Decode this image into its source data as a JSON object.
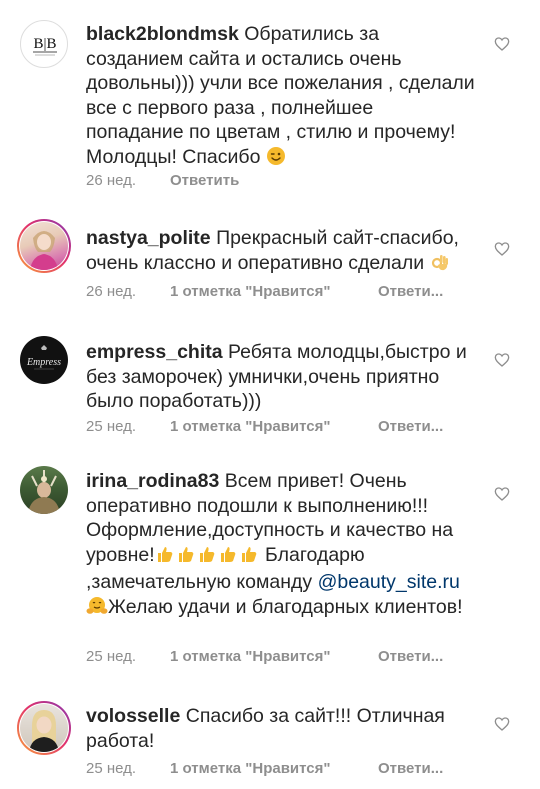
{
  "comments": [
    {
      "username": "black2blondmsk",
      "text": "Обратились за созданием сайта и остались очень довольны))) учли все пожелания , сделали все с первого раза , полнейшее попадание по цветам , стилю и прочему! Молодцы! Спасибо",
      "emoji": "wink-emoji",
      "avatar_text": "B|B",
      "time": "26 нед.",
      "likes": "",
      "reply": "Ответить"
    },
    {
      "username": "nastya_polite",
      "text": "Прекрасный сайт-спасибо, очень классно и оперативно сделали",
      "emoji": "ok-hand-emoji",
      "time": "26 нед.",
      "likes": "1 отметка \"Нравится\"",
      "reply": "Ответи..."
    },
    {
      "username": "empress_chita",
      "text": "Ребята молодцы,быстро и без заморочек) умнички,очень приятно было поработать)))",
      "avatar_text": "Empress",
      "time": "25 нед.",
      "likes": "1 отметка \"Нравится\"",
      "reply": "Ответи..."
    },
    {
      "username": "irina_rodina83",
      "text_part1": "Всем привет!  Очень оперативно подошли к выполнению!!! Оформление,доступность и качество на уровне!",
      "text_part2": "Благодарю ,замечательную команду",
      "mention": "@beauty_site.ru",
      "text_part3": "Желаю удачи и благодарных клиентов!",
      "emoji_thumbs": "thumbs-up-emoji",
      "emoji_hug": "hugging-emoji",
      "time": "25 нед.",
      "likes": "1 отметка \"Нравится\"",
      "reply": "Ответи..."
    },
    {
      "username": "volosselle",
      "text": "Спасибо за сайт!!! Отличная работа!",
      "time": "25 нед.",
      "likes": "1 отметка \"Нравится\"",
      "reply": "Ответи..."
    }
  ],
  "colors": {
    "text": "#262626",
    "meta": "#8e8e8e",
    "link": "#00376b",
    "emoji_yellow": "#f5b92c"
  }
}
